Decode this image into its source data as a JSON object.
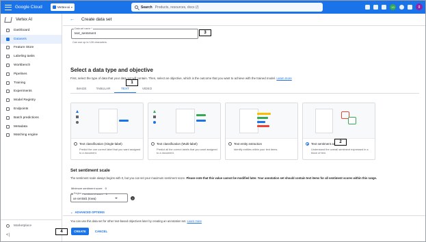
{
  "topbar": {
    "brand": "Google Cloud",
    "project": "Vertex-ai",
    "search_label": "Search",
    "search_placeholder": "Products, resources, docs (/)",
    "notification_count": "13",
    "avatar_initial": "g"
  },
  "sidebar": {
    "title": "Vertex AI",
    "items": [
      {
        "label": "Dashboard",
        "icon": "dashboard-icon"
      },
      {
        "label": "Datasets",
        "icon": "datasets-icon",
        "active": true
      },
      {
        "label": "Feature Store",
        "icon": "feature-store-icon"
      },
      {
        "label": "Labeling tasks",
        "icon": "labeling-icon"
      },
      {
        "label": "Workbench",
        "icon": "workbench-icon"
      },
      {
        "label": "Pipelines",
        "icon": "pipelines-icon"
      },
      {
        "label": "Training",
        "icon": "training-icon"
      },
      {
        "label": "Experiments",
        "icon": "experiments-icon"
      },
      {
        "label": "Model Registry",
        "icon": "model-registry-icon"
      },
      {
        "label": "Endpoints",
        "icon": "endpoints-icon"
      },
      {
        "label": "Batch predictions",
        "icon": "batch-predictions-icon"
      },
      {
        "label": "Metadata",
        "icon": "metadata-icon"
      },
      {
        "label": "Matching engine",
        "icon": "matching-engine-icon"
      }
    ],
    "footer_label": "Marketplace",
    "collapse_glyph": "<|"
  },
  "page": {
    "back_glyph": "←",
    "title": "Create data set"
  },
  "dataset_name": {
    "label": "Data set name *",
    "value": "text_sentiment",
    "help": "Can use up to 128 characters."
  },
  "data_type": {
    "title": "Select a data type and objective",
    "description": "First, select the type of data that your data set will contain. Then, select an objective, which is the outcome that you want to achieve with the trained model.",
    "learn_more": "Learn more",
    "tabs": [
      "IMAGE",
      "TABULAR",
      "TEXT",
      "VIDEO"
    ],
    "active_tab": "TEXT"
  },
  "cards": [
    {
      "title": "Text classification (Single-label)",
      "description": "Predict the one correct label that you want assigned to a document.",
      "selected": false
    },
    {
      "title": "Text classification (Multi-label)",
      "description": "Predict all the correct labels that you want assigned to a document.",
      "selected": false
    },
    {
      "title": "Text entity extraction",
      "description": "Identify entities within your text items.",
      "selected": false
    },
    {
      "title": "Text sentiment analysis",
      "description": "Understand the overall sentiment expressed in a block of text.",
      "selected": true
    }
  ],
  "sentiment": {
    "title": "Set sentiment scale",
    "desc_plain": "The sentiment scale always begins with 0, but you can set your maximum sentiment score.",
    "desc_bold": "Please note that this value cannot be modified later. Your annotation set should contain text items for all sentiment scores within this range.",
    "min_label": "Minimum sentiment score",
    "min_value": "0",
    "max_label": "Maximum sentiment score",
    "max_value": "1"
  },
  "region": {
    "label": "Region",
    "value": "us-central1 (Iowa)",
    "help_glyph": "?"
  },
  "advanced": {
    "chevron": "⌄",
    "label": "ADVANCED OPTIONS"
  },
  "footnote": {
    "text": "You can use this data set for other text-based objectives later by creating an annotation set.",
    "link": "Learn more"
  },
  "actions": {
    "create": "CREATE",
    "cancel": "CANCEL"
  },
  "callouts": {
    "c1": "1",
    "c2": "2",
    "c3": "3",
    "c4": "4"
  },
  "colors": {
    "accent": "#1a73e8",
    "sidebar_active_bg": "#e8f0fe"
  }
}
